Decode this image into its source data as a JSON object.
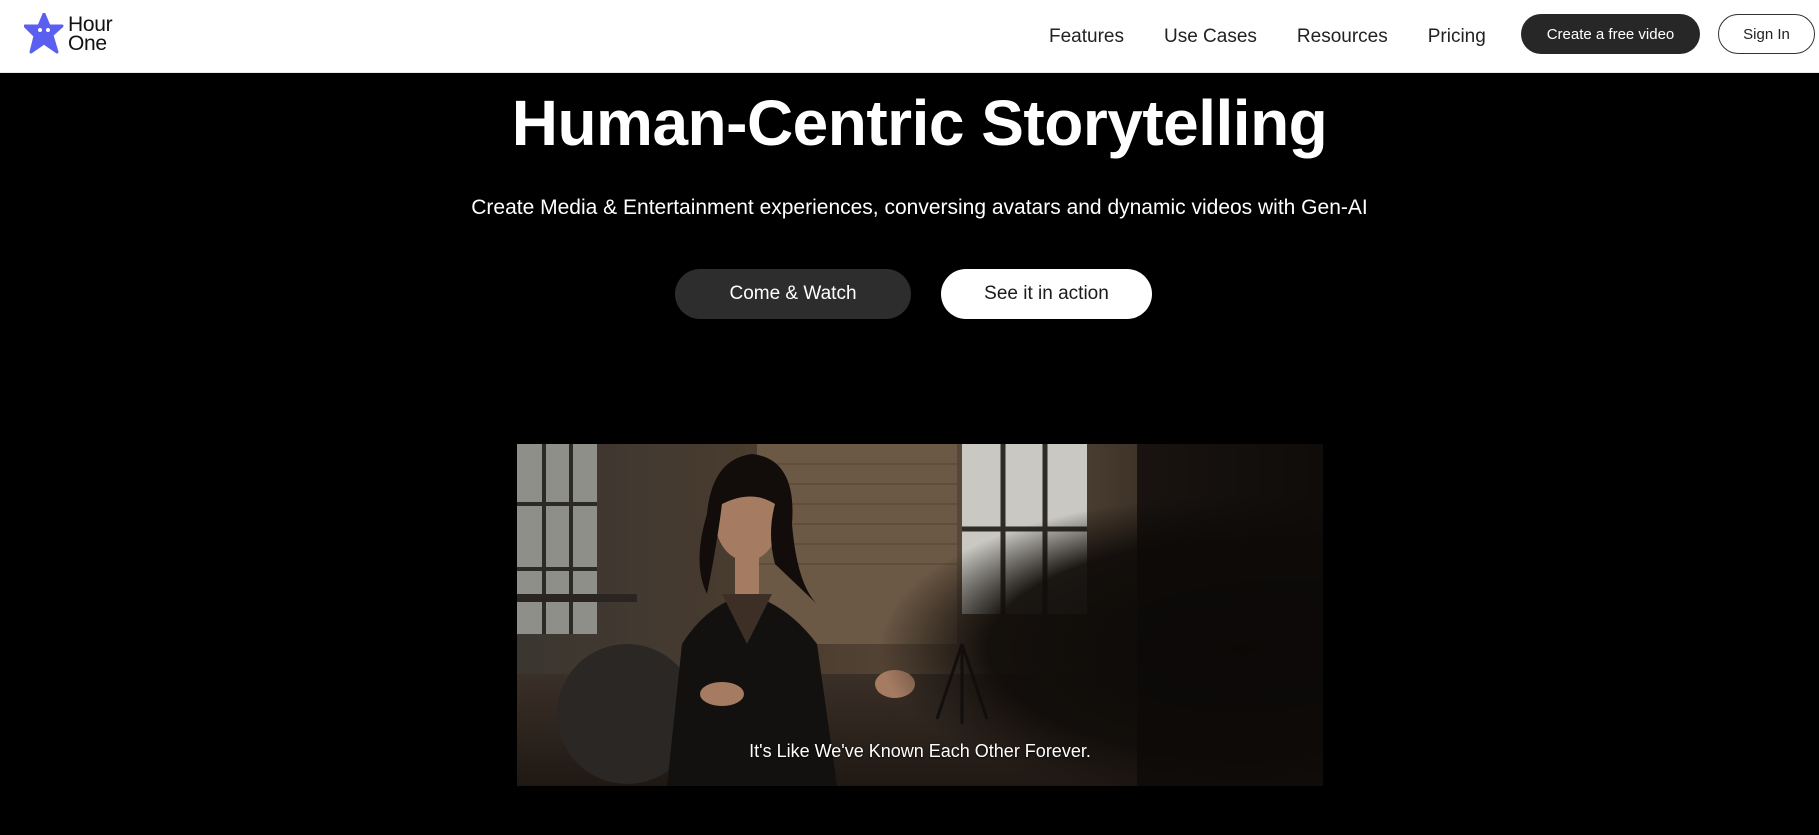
{
  "brand": {
    "logo_line1": "Hour",
    "logo_line2": "One",
    "accent_color": "#5b5ff0"
  },
  "nav": {
    "items": [
      {
        "label": "Features"
      },
      {
        "label": "Use Cases"
      },
      {
        "label": "Resources"
      },
      {
        "label": "Pricing"
      }
    ],
    "cta_label": "Create a free video",
    "signin_label": "Sign In"
  },
  "hero": {
    "title": "Human-Centric Storytelling",
    "subtitle": "Create Media & Entertainment experiences, conversing avatars and dynamic videos with Gen-AI",
    "primary_button": "Come & Watch",
    "secondary_button": "See it in action"
  },
  "video": {
    "caption": "It's Like We've Known Each Other Forever."
  }
}
